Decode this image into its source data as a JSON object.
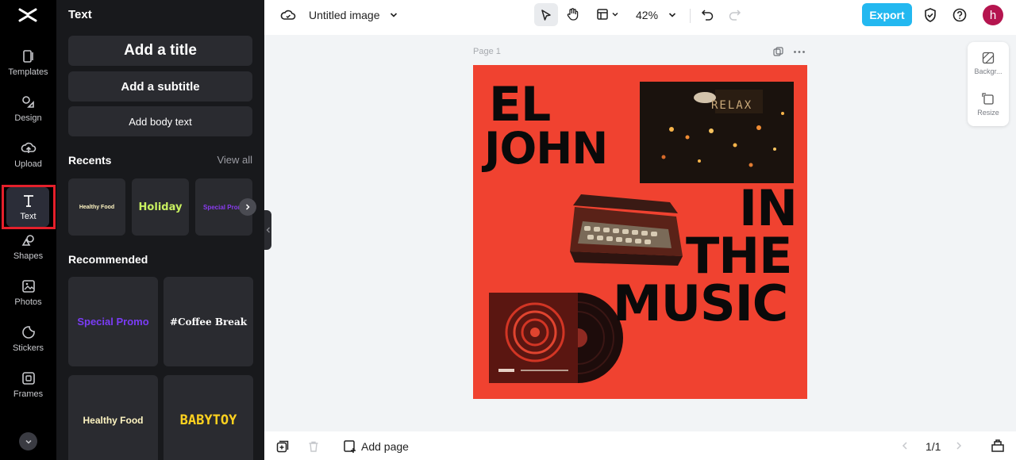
{
  "rail": {
    "items": [
      {
        "label": "Templates",
        "icon": "templates-icon"
      },
      {
        "label": "Design",
        "icon": "design-icon"
      },
      {
        "label": "Upload",
        "icon": "upload-icon"
      },
      {
        "label": "Text",
        "icon": "text-icon"
      },
      {
        "label": "Shapes",
        "icon": "shapes-icon"
      },
      {
        "label": "Photos",
        "icon": "photos-icon"
      },
      {
        "label": "Stickers",
        "icon": "stickers-icon"
      },
      {
        "label": "Frames",
        "icon": "frames-icon"
      }
    ],
    "active": "Text"
  },
  "panel": {
    "title": "Text",
    "add_title": "Add a title",
    "add_subtitle": "Add a subtitle",
    "add_body": "Add body text",
    "recents_label": "Recents",
    "view_all": "View all",
    "recents": [
      "Healthy Food",
      "Holiday",
      "Special Promo"
    ],
    "recommended_label": "Recommended",
    "recommended": [
      "Special Promo",
      "#Coffee Break",
      "Healthy Food",
      "BABYTOY"
    ]
  },
  "topbar": {
    "doc_title": "Untitled image",
    "zoom": "42%",
    "export_label": "Export",
    "avatar_initial": "h"
  },
  "canvas": {
    "page_label": "Page 1",
    "poster": {
      "line1": "EL",
      "line2": "JOHN",
      "line3": "IN",
      "line4": "THE",
      "line5": "MUSIC",
      "photo_sign": "RELAX"
    }
  },
  "float_panel": {
    "background_label": "Backgr...",
    "resize_label": "Resize"
  },
  "bottombar": {
    "add_page_label": "Add page",
    "page_counter": "1/1"
  },
  "colors": {
    "accent": "#23b8f0",
    "poster_bg": "#f04230",
    "avatar": "#b5154f",
    "highlight_frame": "#e5202b"
  }
}
